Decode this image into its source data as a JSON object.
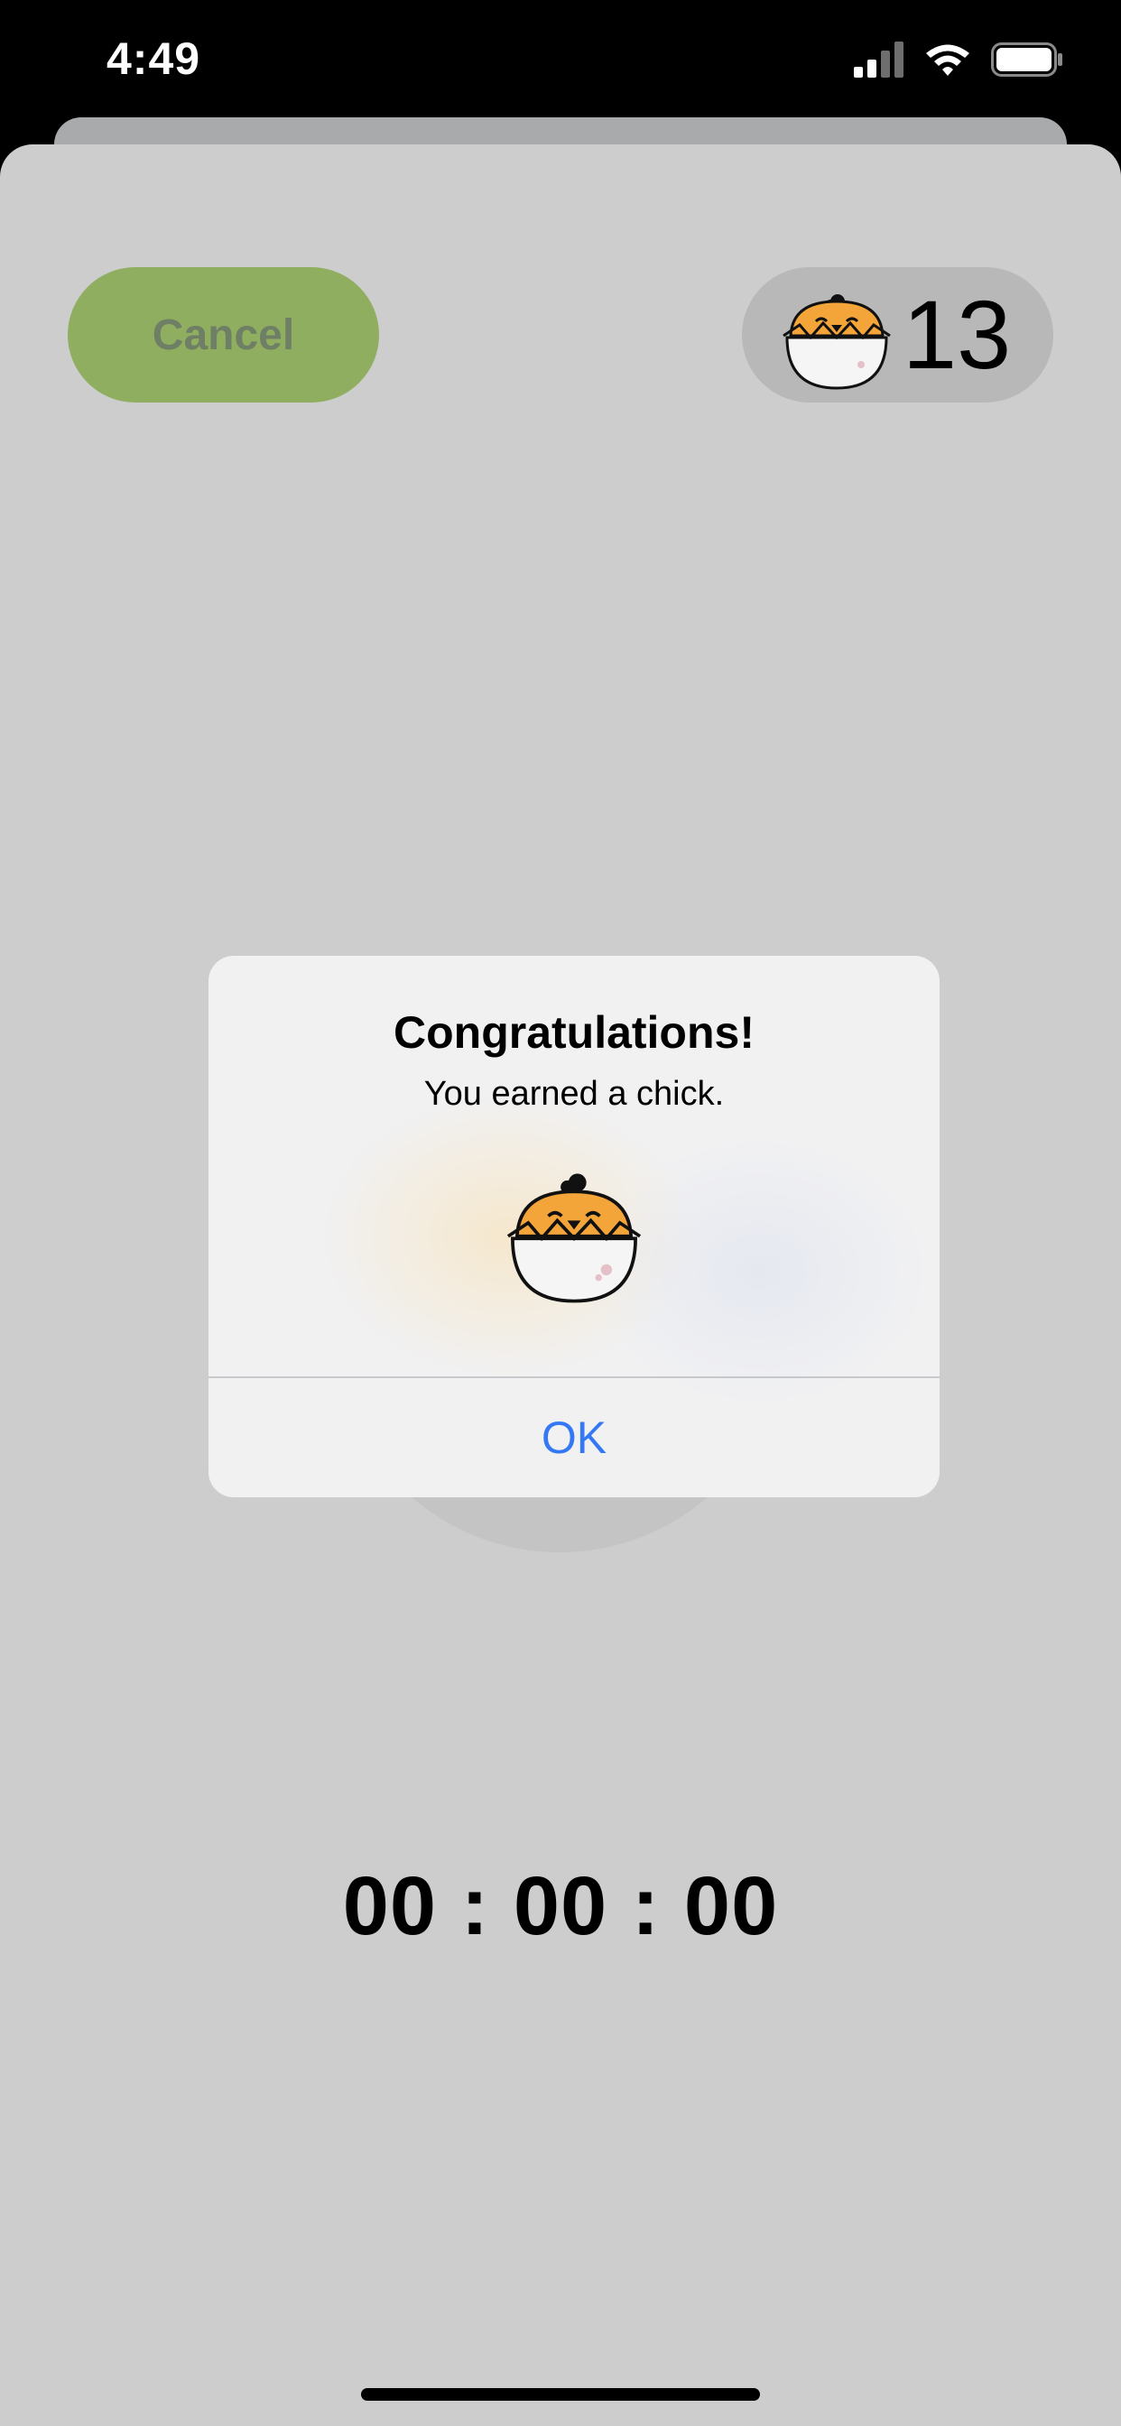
{
  "status_bar": {
    "time": "4:49",
    "icons": [
      "cellular-signal-icon",
      "wifi-icon",
      "battery-icon"
    ]
  },
  "header": {
    "cancel_label": "Cancel",
    "chick_count": "13",
    "chick_icon": "chick-in-egg-icon"
  },
  "timer": {
    "display": "00 : 00 : 00"
  },
  "alert": {
    "title": "Congratulations!",
    "message": "You earned a chick.",
    "image": "chick-in-egg-icon",
    "ok_label": "OK"
  },
  "colors": {
    "cancel_button": "#8fae5f",
    "background": "#cdcdcd",
    "alert_button": "#3478f6",
    "chick": "#f3a53a"
  }
}
